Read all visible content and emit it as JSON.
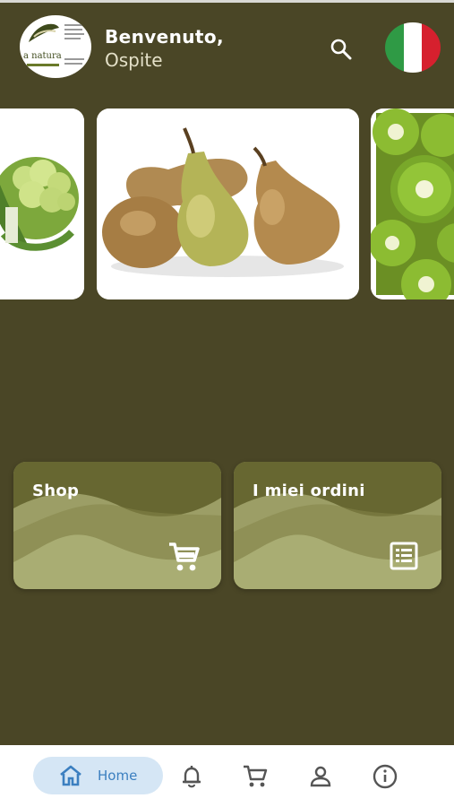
{
  "header": {
    "greeting": "Benvenuto,",
    "user_name": "Ospite",
    "logo": {
      "text": "a natura",
      "icon": "leaf-logo-icon"
    },
    "search_icon": "search-icon",
    "language_flag": {
      "name": "italy-flag-icon",
      "colors": [
        "#2f9a45",
        "#ffffff",
        "#d6202e"
      ]
    }
  },
  "carousel": {
    "slides": [
      {
        "name": "cauliflower-image"
      },
      {
        "name": "pears-image"
      },
      {
        "name": "kiwi-image"
      }
    ]
  },
  "tiles": [
    {
      "label": "Shop",
      "icon": "cart-icon"
    },
    {
      "label": "I miei ordini",
      "icon": "orders-list-icon"
    }
  ],
  "bottom_nav": {
    "items": [
      {
        "label": "Home",
        "icon": "home-icon",
        "active": true
      },
      {
        "icon": "bell-icon"
      },
      {
        "icon": "cart-icon"
      },
      {
        "icon": "user-icon"
      },
      {
        "icon": "info-icon"
      }
    ]
  },
  "colors": {
    "background": "#4a4626",
    "tile": "#9c9e66",
    "nav_active_bg": "#d5e6f5",
    "nav_active_fg": "#3b7fc0"
  }
}
